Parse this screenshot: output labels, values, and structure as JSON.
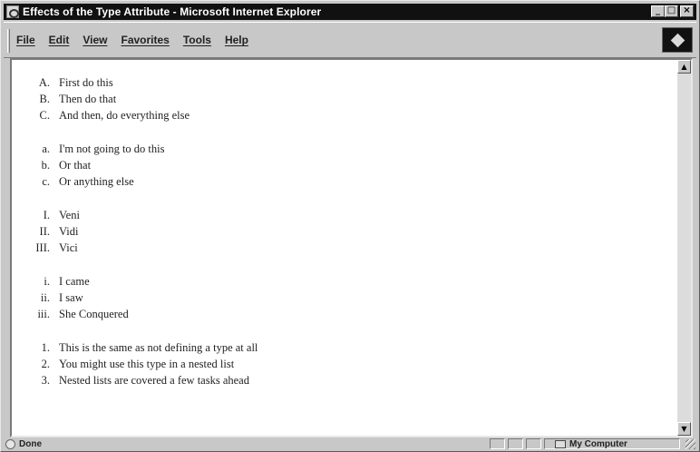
{
  "window": {
    "title": "Effects of the Type Attribute - Microsoft Internet Explorer",
    "controls": {
      "minimize": "_",
      "maximize": "□",
      "close": "×"
    }
  },
  "menu": {
    "items": [
      "File",
      "Edit",
      "View",
      "Favorites",
      "Tools",
      "Help"
    ]
  },
  "content": {
    "lists": [
      {
        "type": "A",
        "items": [
          {
            "marker": "A.",
            "text": "First do this"
          },
          {
            "marker": "B.",
            "text": "Then do that"
          },
          {
            "marker": "C.",
            "text": "And then, do everything else"
          }
        ]
      },
      {
        "type": "a",
        "items": [
          {
            "marker": "a.",
            "text": "I'm not going to do this"
          },
          {
            "marker": "b.",
            "text": "Or that"
          },
          {
            "marker": "c.",
            "text": "Or anything else"
          }
        ]
      },
      {
        "type": "I",
        "items": [
          {
            "marker": "I.",
            "text": "Veni"
          },
          {
            "marker": "II.",
            "text": "Vidi"
          },
          {
            "marker": "III.",
            "text": "Vici"
          }
        ]
      },
      {
        "type": "i",
        "items": [
          {
            "marker": "i.",
            "text": "I came"
          },
          {
            "marker": "ii.",
            "text": "I saw"
          },
          {
            "marker": "iii.",
            "text": "She Conquered"
          }
        ]
      },
      {
        "type": "1",
        "items": [
          {
            "marker": "1.",
            "text": "This is the same as not defining a type at all"
          },
          {
            "marker": "2.",
            "text": "You might use this type in a nested list"
          },
          {
            "marker": "3.",
            "text": "Nested lists are covered a few tasks ahead"
          }
        ]
      }
    ]
  },
  "status": {
    "text": "Done",
    "zone": "My Computer"
  }
}
